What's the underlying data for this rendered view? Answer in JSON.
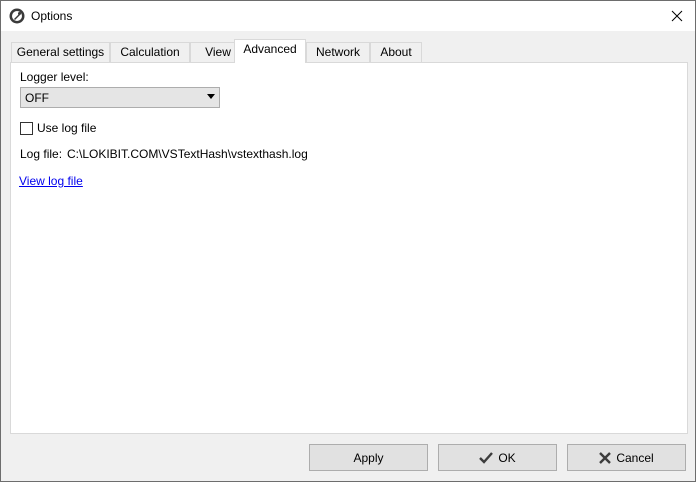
{
  "window": {
    "title": "Options"
  },
  "tabs": [
    {
      "label": "General settings"
    },
    {
      "label": "Calculation"
    },
    {
      "label": "View"
    },
    {
      "label": "Advanced"
    },
    {
      "label": "Network"
    },
    {
      "label": "About"
    }
  ],
  "active_tab": "Advanced",
  "advanced": {
    "logger_level_label": "Logger level:",
    "logger_level_value": "OFF",
    "use_log_file_label": "Use log file",
    "use_log_file_checked": false,
    "log_file_label": "Log file:",
    "log_file_path": "C:\\LOKIBIT.COM\\VSTextHash\\vstexthash.log",
    "view_log_link": "View log file"
  },
  "buttons": {
    "apply": "Apply",
    "ok": "OK",
    "cancel": "Cancel"
  },
  "icons": {
    "app": "app-icon",
    "close": "close-icon",
    "dropdown": "chevron-down-icon",
    "ok": "checkmark-icon",
    "cancel": "x-icon"
  },
  "colors": {
    "link": "#0000ee",
    "panel_bg": "#ffffff",
    "window_bg": "#f0f0f0"
  }
}
